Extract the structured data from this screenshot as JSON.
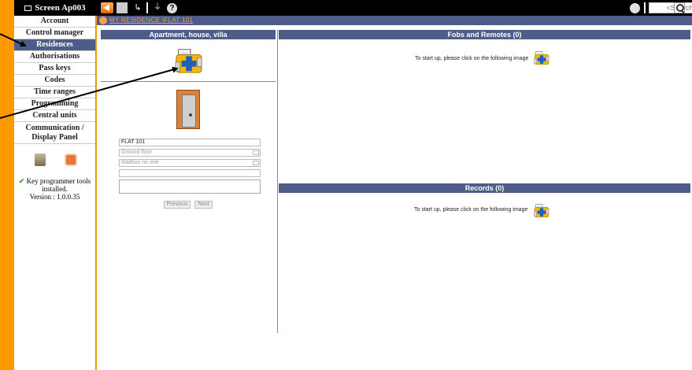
{
  "app": {
    "screen_title": "Screen Ap003"
  },
  "search": {
    "placeholder": "<Search>"
  },
  "sidebar": {
    "items": [
      {
        "label": "Account",
        "active": false
      },
      {
        "label": "Control manager",
        "active": false
      },
      {
        "label": "Residences",
        "active": true
      },
      {
        "label": "Authorisations",
        "active": false
      },
      {
        "label": "Pass keys",
        "active": false
      },
      {
        "label": "Codes",
        "active": false
      },
      {
        "label": "Time ranges",
        "active": false
      },
      {
        "label": "Programming",
        "active": false
      },
      {
        "label": "Central units",
        "active": false
      },
      {
        "label": "Communication / Display Panel",
        "active": false
      }
    ],
    "status_text": "Key programmer tools installed.",
    "version": "Version : 1.0.0.35"
  },
  "breadcrumb": "MY RESIDENCE \\FLAT 101",
  "left_panel": {
    "title": "Apartment, house, villa",
    "flat_name": "FLAT 101",
    "floor": "Ground floor",
    "mailbox": "Mailbox no one",
    "previous_label": "Previous",
    "next_label": "Next"
  },
  "fobs": {
    "title": "Fobs and Remotes (0)",
    "startup_text": "To start up, please click on the following image"
  },
  "records": {
    "title": "Records (0)",
    "startup_text": "To start up, please click on the following image"
  },
  "colors": {
    "accent": "#ff9900",
    "header": "#4d5d88",
    "link": "#f39c45"
  }
}
